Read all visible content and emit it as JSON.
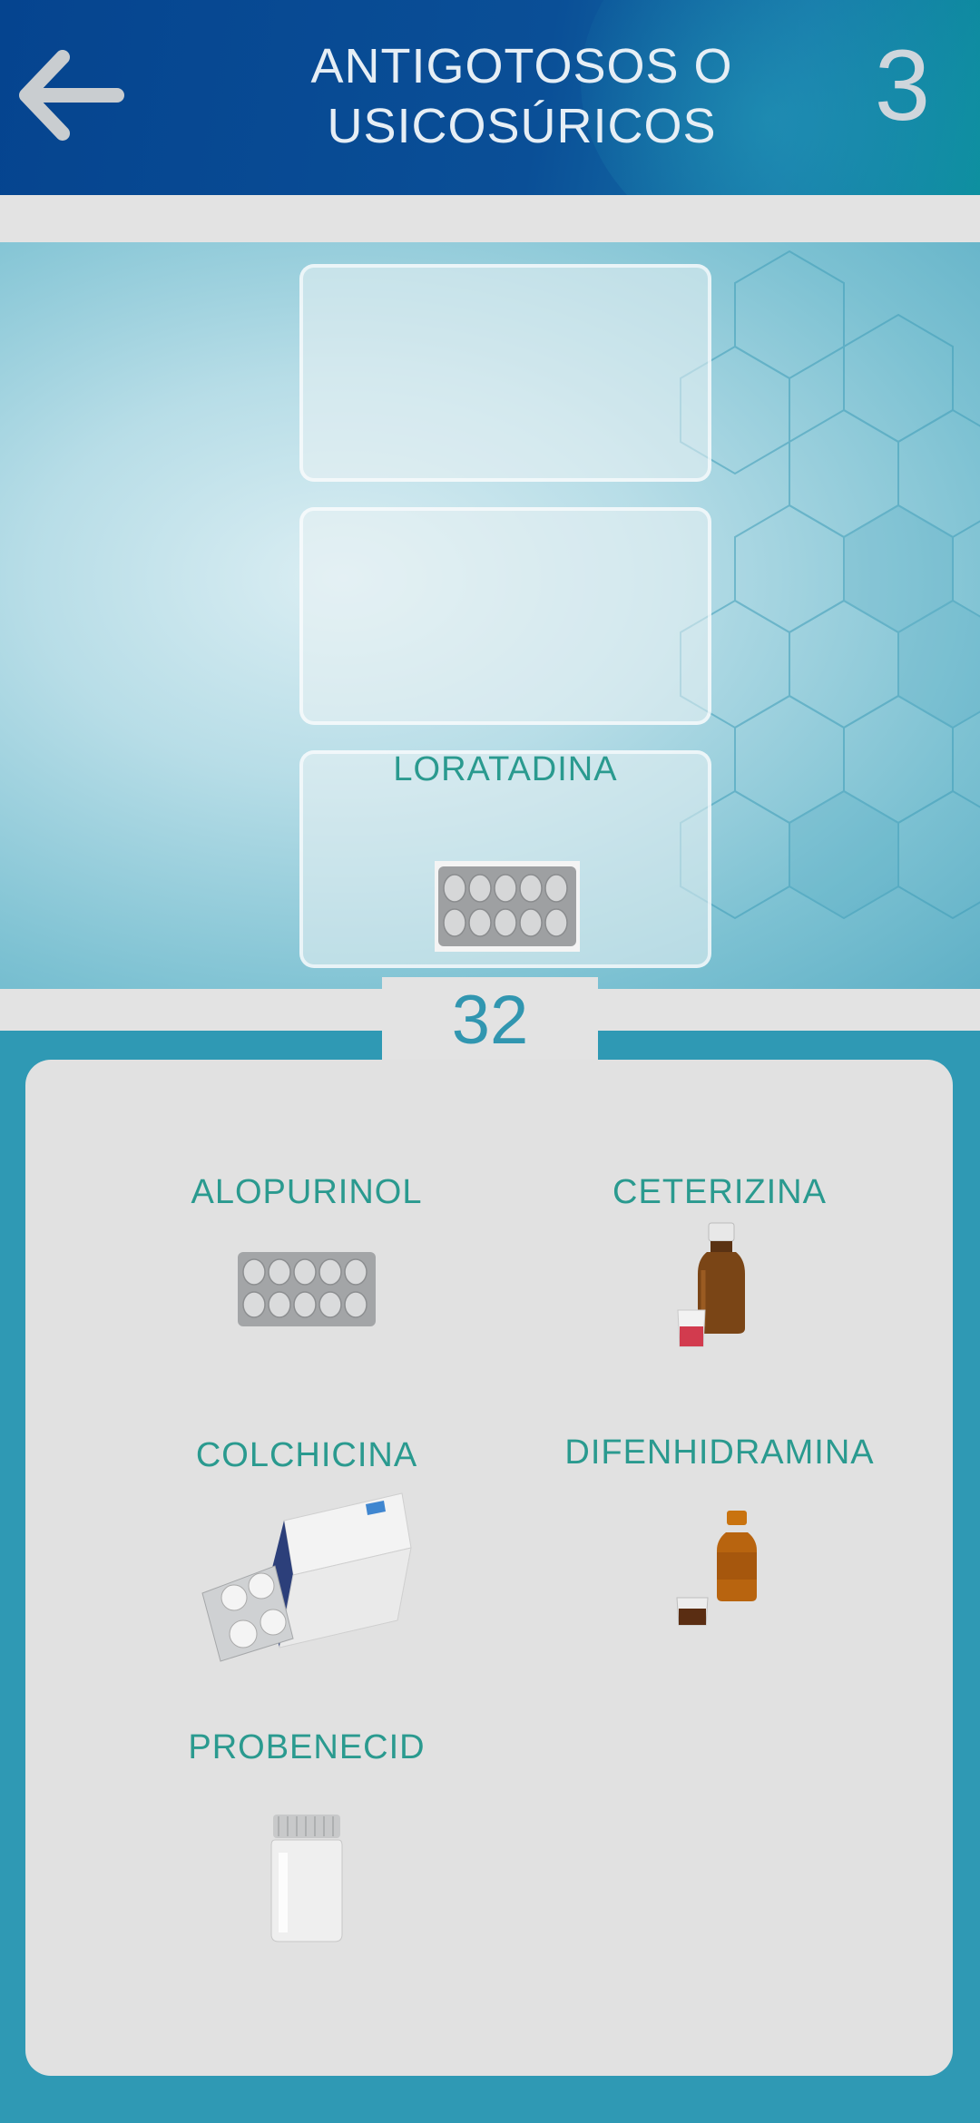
{
  "header": {
    "back_icon": "arrow-left-icon",
    "title_line1": "ANTIGOTOSOS O",
    "title_line2": "USICOSÚRICOS",
    "level": "3"
  },
  "slots": [
    {
      "label": "",
      "image": ""
    },
    {
      "label": "",
      "image": ""
    },
    {
      "label": "LORATADINA",
      "image": "blister-pack-icon"
    }
  ],
  "score": "32",
  "options": [
    {
      "label": "ALOPURINOL",
      "image": "blister-pack-icon"
    },
    {
      "label": "CETERIZINA",
      "image": "syrup-bottle-icon"
    },
    {
      "label": "COLCHICINA",
      "image": "pill-box-icon"
    },
    {
      "label": "DIFENHIDRAMINA",
      "image": "small-syrup-bottle-icon"
    },
    {
      "label": "PROBENECID",
      "image": "pill-bottle-icon"
    }
  ],
  "colors": {
    "header": "#05448f",
    "label_teal": "#2a9a8f",
    "score": "#3196b0",
    "background": "#2f99b4"
  }
}
